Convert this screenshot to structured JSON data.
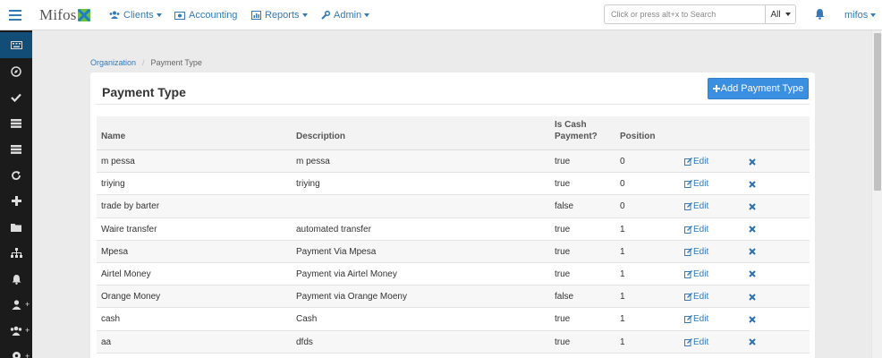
{
  "topbar": {
    "logo": "Mifos",
    "nav": [
      {
        "label": "Clients",
        "icon": "users-icon",
        "dropdown": true
      },
      {
        "label": "Accounting",
        "icon": "money-icon",
        "dropdown": false
      },
      {
        "label": "Reports",
        "icon": "chart-icon",
        "dropdown": true
      },
      {
        "label": "Admin",
        "icon": "wrench-icon",
        "dropdown": true
      }
    ],
    "search_placeholder": "Click or press alt+x to Search",
    "search_scope": "All",
    "user": "mifos"
  },
  "breadcrumb": {
    "parent": "Organization",
    "current": "Payment Type"
  },
  "panel": {
    "title": "Payment Type",
    "add_button": "Add Payment Type"
  },
  "table": {
    "headers": {
      "name": "Name",
      "description": "Description",
      "is_cash_line1": "Is Cash",
      "is_cash_line2": "Payment?",
      "position": "Position"
    },
    "edit_label": "Edit",
    "rows": [
      {
        "name": "m pessa",
        "description": "m pessa",
        "is_cash": "true",
        "position": "0"
      },
      {
        "name": "triying",
        "description": "triying",
        "is_cash": "true",
        "position": "0"
      },
      {
        "name": "trade by barter",
        "description": "",
        "is_cash": "false",
        "position": "0"
      },
      {
        "name": "Waire transfer",
        "description": "automated transfer",
        "is_cash": "true",
        "position": "1"
      },
      {
        "name": "Mpesa",
        "description": "Payment Via Mpesa",
        "is_cash": "true",
        "position": "1"
      },
      {
        "name": "Airtel Money",
        "description": "Payment via Airtel Money",
        "is_cash": "true",
        "position": "1"
      },
      {
        "name": "Orange Money",
        "description": "Payment via Orange Moeny",
        "is_cash": "false",
        "position": "1"
      },
      {
        "name": "cash",
        "description": "Cash",
        "is_cash": "true",
        "position": "1"
      },
      {
        "name": "aa",
        "description": "dfds",
        "is_cash": "true",
        "position": "1"
      }
    ]
  },
  "colors": {
    "accent": "#337ab7",
    "button": "#3b8fe0",
    "sidebar": "#1b1b1b",
    "sidebar_active": "#124d78"
  }
}
